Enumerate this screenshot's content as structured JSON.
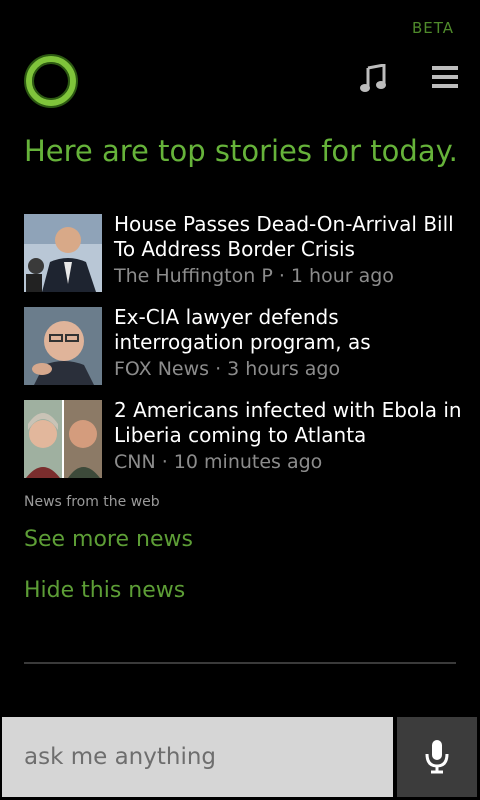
{
  "status": {
    "beta_label": "BETA"
  },
  "header": {
    "logo_icon": "cortana-circle-icon",
    "music_icon": "music-note-icon",
    "menu_icon": "hamburger-menu-icon"
  },
  "heading": "Here are top stories for today.",
  "news": {
    "items": [
      {
        "title": "House Passes Dead-On-Arrival Bill To Address Border Crisis",
        "meta": "The Huffington P · 1 hour ago"
      },
      {
        "title": "Ex-CIA lawyer defends interrogation program, as",
        "meta": "FOX News · 3 hours ago"
      },
      {
        "title": "2 Americans infected with Ebola in Liberia coming to Atlanta",
        "meta": "CNN · 10 minutes ago"
      }
    ],
    "source_label": "News from the web",
    "see_more": "See more news",
    "hide": "Hide this news"
  },
  "search": {
    "placeholder": "ask me anything",
    "mic_icon": "microphone-icon"
  },
  "colors": {
    "accent": "#66b33a",
    "background": "#000000"
  }
}
